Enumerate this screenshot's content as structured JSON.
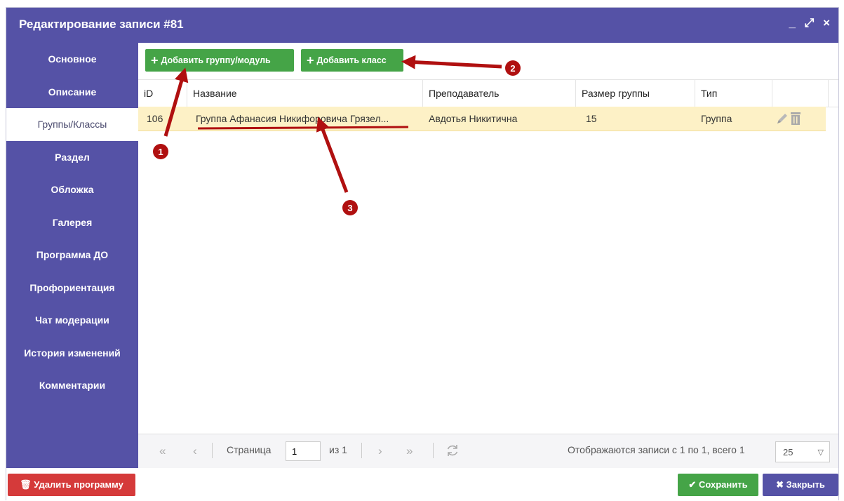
{
  "window": {
    "title": "Редактирование записи #81",
    "controls": {
      "minimize": "_",
      "maximize": "⤢",
      "close": "×"
    }
  },
  "sidebar": {
    "items": [
      {
        "label": "Основное"
      },
      {
        "label": "Описание"
      },
      {
        "label": "Группы/Классы",
        "active": true
      },
      {
        "label": "Раздел"
      },
      {
        "label": "Обложка"
      },
      {
        "label": "Галерея"
      },
      {
        "label": "Программа ДО"
      },
      {
        "label": "Профориентация"
      },
      {
        "label": "Чат модерации"
      },
      {
        "label": "История изменений"
      },
      {
        "label": "Комментарии"
      }
    ]
  },
  "toolbar": {
    "add_group_label": "Добавить группу/модуль",
    "add_class_label": "Добавить класс"
  },
  "table": {
    "columns": [
      "iD",
      "Название",
      "Преподаватель",
      "Размер группы",
      "Тип"
    ],
    "rows": [
      {
        "id": "106",
        "name": "Группа Афанасия Никифоровича Грязел...",
        "teacher": "Авдотья Никитична",
        "size": "15",
        "type": "Группа"
      }
    ]
  },
  "pager": {
    "page_label": "Страница",
    "page_value": "1",
    "of_label": "из 1",
    "records_text": "Отображаются записи с 1 по 1, всего 1",
    "page_size": "25"
  },
  "footer": {
    "delete_label": "Удалить программу",
    "save_label": "Сохранить",
    "close_label": "Закрыть"
  },
  "annotations": [
    "1",
    "2",
    "3"
  ],
  "colors": {
    "accent": "#5552a6",
    "green": "#45a447",
    "danger": "#d53a3a",
    "row_selected": "#fdf1c6",
    "marker": "#b01010"
  }
}
